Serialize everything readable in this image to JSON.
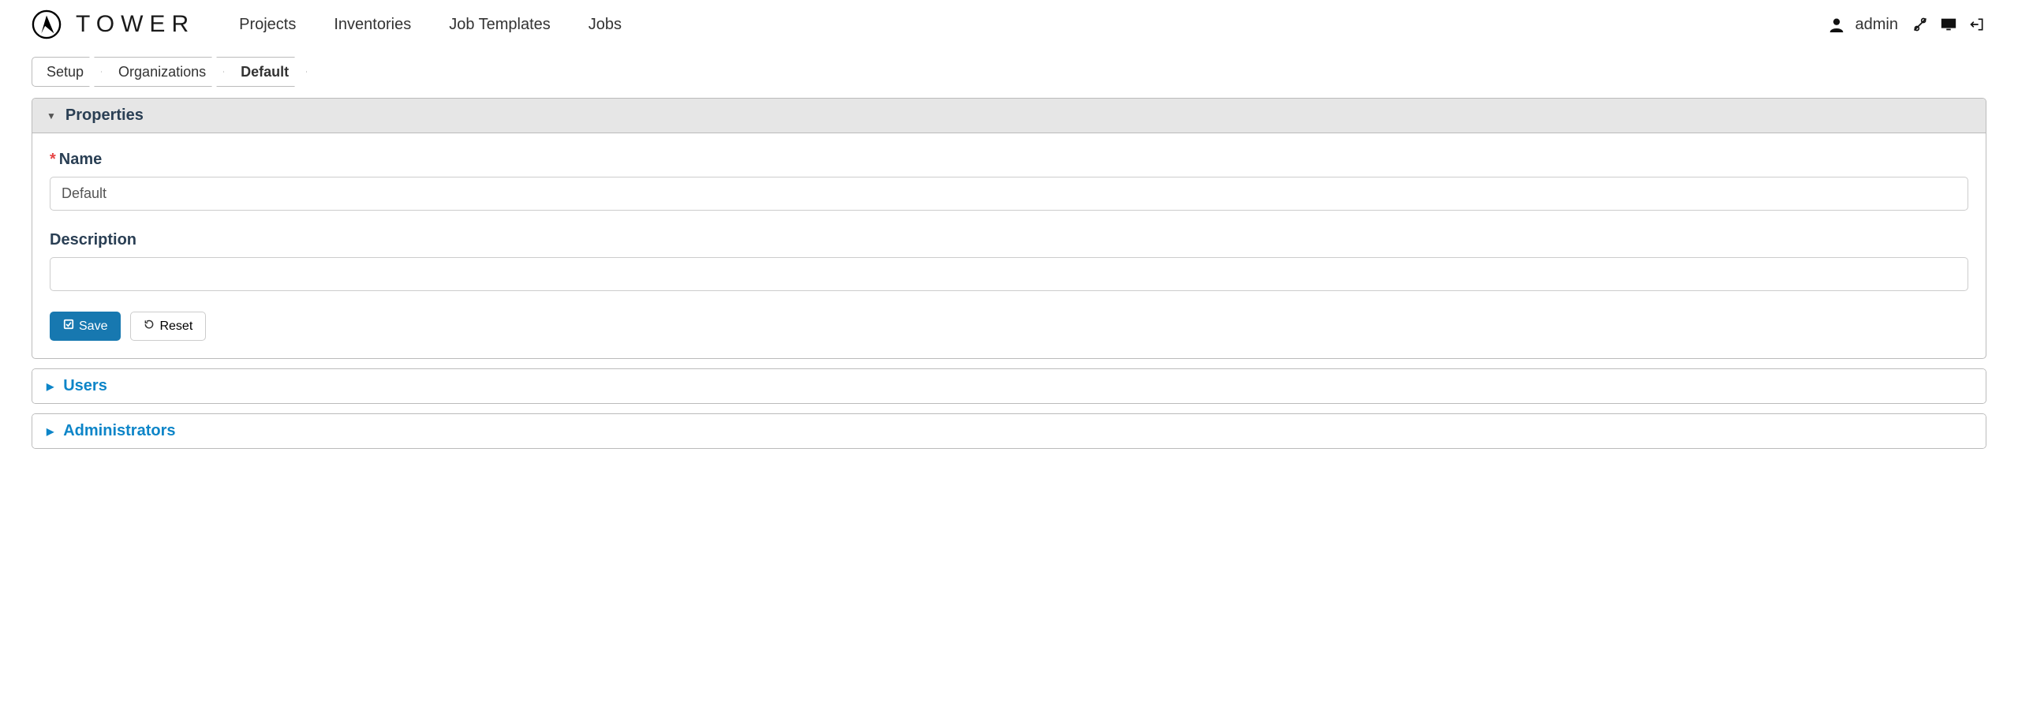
{
  "brand": "TOWER",
  "nav": {
    "items": [
      "Projects",
      "Inventories",
      "Job Templates",
      "Jobs"
    ],
    "user": "admin"
  },
  "breadcrumb": {
    "items": [
      {
        "label": "Setup",
        "active": false
      },
      {
        "label": "Organizations",
        "active": false
      },
      {
        "label": "Default",
        "active": true
      }
    ]
  },
  "properties": {
    "title": "Properties",
    "name_label": "Name",
    "name_value": "Default",
    "description_label": "Description",
    "description_value": "",
    "save_label": "Save",
    "reset_label": "Reset"
  },
  "section_users": "Users",
  "section_admins": "Administrators"
}
